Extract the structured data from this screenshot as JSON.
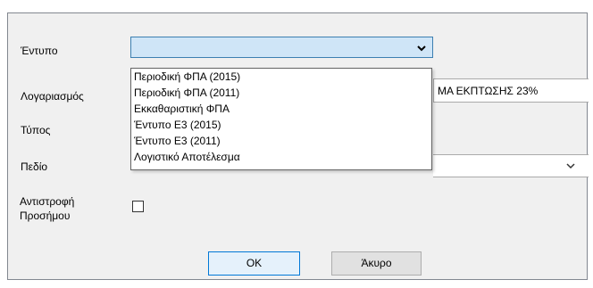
{
  "form": {
    "printout_label": "Έντυπο",
    "account_label": "Λογαριασμός",
    "type_label": "Τύπος",
    "field_label": "Πεδίο",
    "invert_sign_label_line1": "Αντιστροφή",
    "invert_sign_label_line2": "Προσήμου",
    "printout_value": "",
    "account_value_visible_part": "ΜΑ ΕΚΠΤΩΣΗΣ 23%",
    "field_value": "",
    "invert_sign_checked": false
  },
  "dropdown": {
    "options": [
      "Περιοδική ΦΠΑ (2015)",
      "Περιοδική ΦΠΑ (2011)",
      "Εκκαθαριστική ΦΠΑ",
      "Έντυπο Ε3 (2015)",
      "Έντυπο Ε3 (2011)",
      "Λογιστικό Αποτέλεσμα"
    ]
  },
  "buttons": {
    "ok_label": "OK",
    "cancel_label": "Άκυρο"
  },
  "icons": {
    "combo_arrow": "chevron-down-icon"
  },
  "colors": {
    "active_combo_fill": "#cfe5f7",
    "active_combo_border": "#3c7fb1",
    "default_button_border": "#0078d7",
    "dialog_background": "#f0f0f0"
  }
}
